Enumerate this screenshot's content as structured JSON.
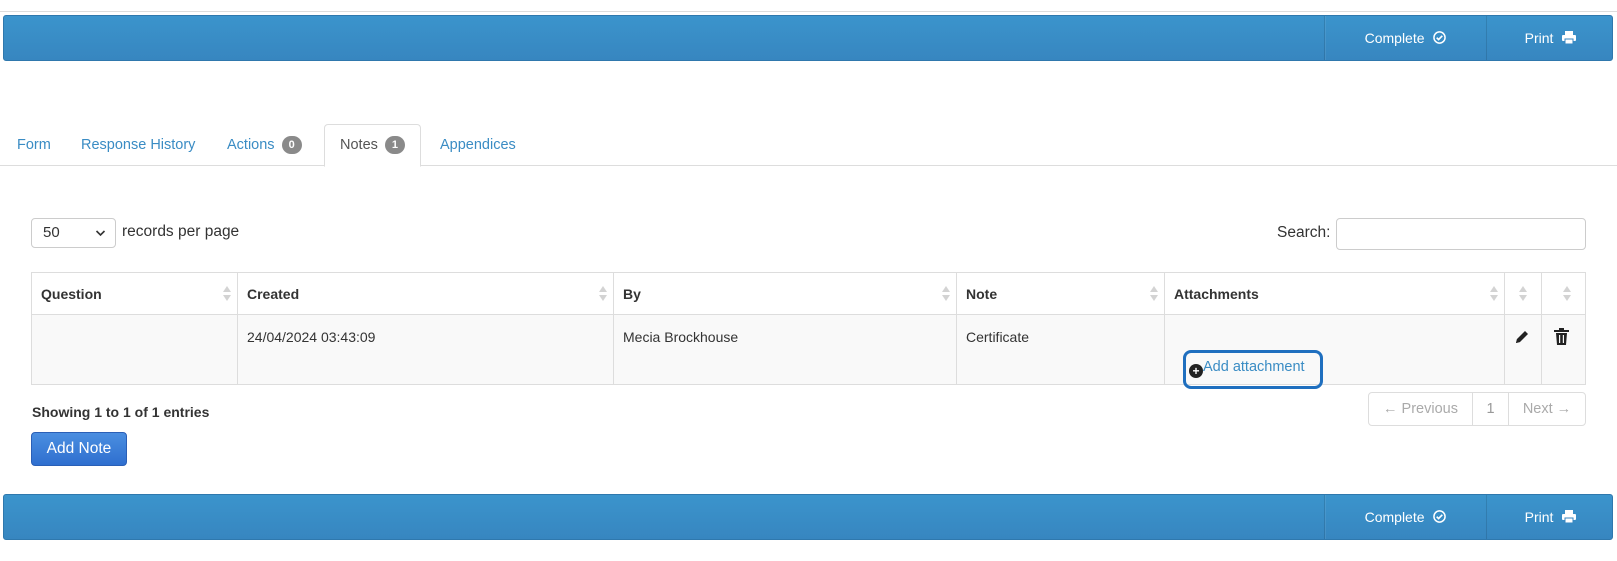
{
  "toolbar": {
    "complete_label": "Complete",
    "print_label": "Print"
  },
  "tabs": [
    {
      "label": "Form"
    },
    {
      "label": "Response History"
    },
    {
      "label": "Actions",
      "badge": "0"
    },
    {
      "label": "Notes",
      "badge": "1",
      "active": true
    },
    {
      "label": "Appendices"
    }
  ],
  "length": {
    "value": "50",
    "label": "records per page"
  },
  "search": {
    "label": "Search:",
    "value": "",
    "placeholder": ""
  },
  "table": {
    "columns": [
      "Question",
      "Created",
      "By",
      "Note",
      "Attachments",
      "",
      ""
    ],
    "rows": [
      {
        "question": "",
        "created": "24/04/2024 03:43:09",
        "by": "Mecia Brockhouse",
        "note": "Certificate",
        "attachment_link": "Add attachment"
      }
    ]
  },
  "info": "Showing 1 to 1 of 1 entries",
  "pagination": {
    "prev": "← Previous",
    "page": "1",
    "next": "Next →"
  },
  "add_note_label": "Add Note",
  "colors": {
    "toolbar": "#3b94cc",
    "link": "#3a8cc4",
    "primary_button": "#3d7fd9",
    "highlight": "#1f6fbf"
  }
}
